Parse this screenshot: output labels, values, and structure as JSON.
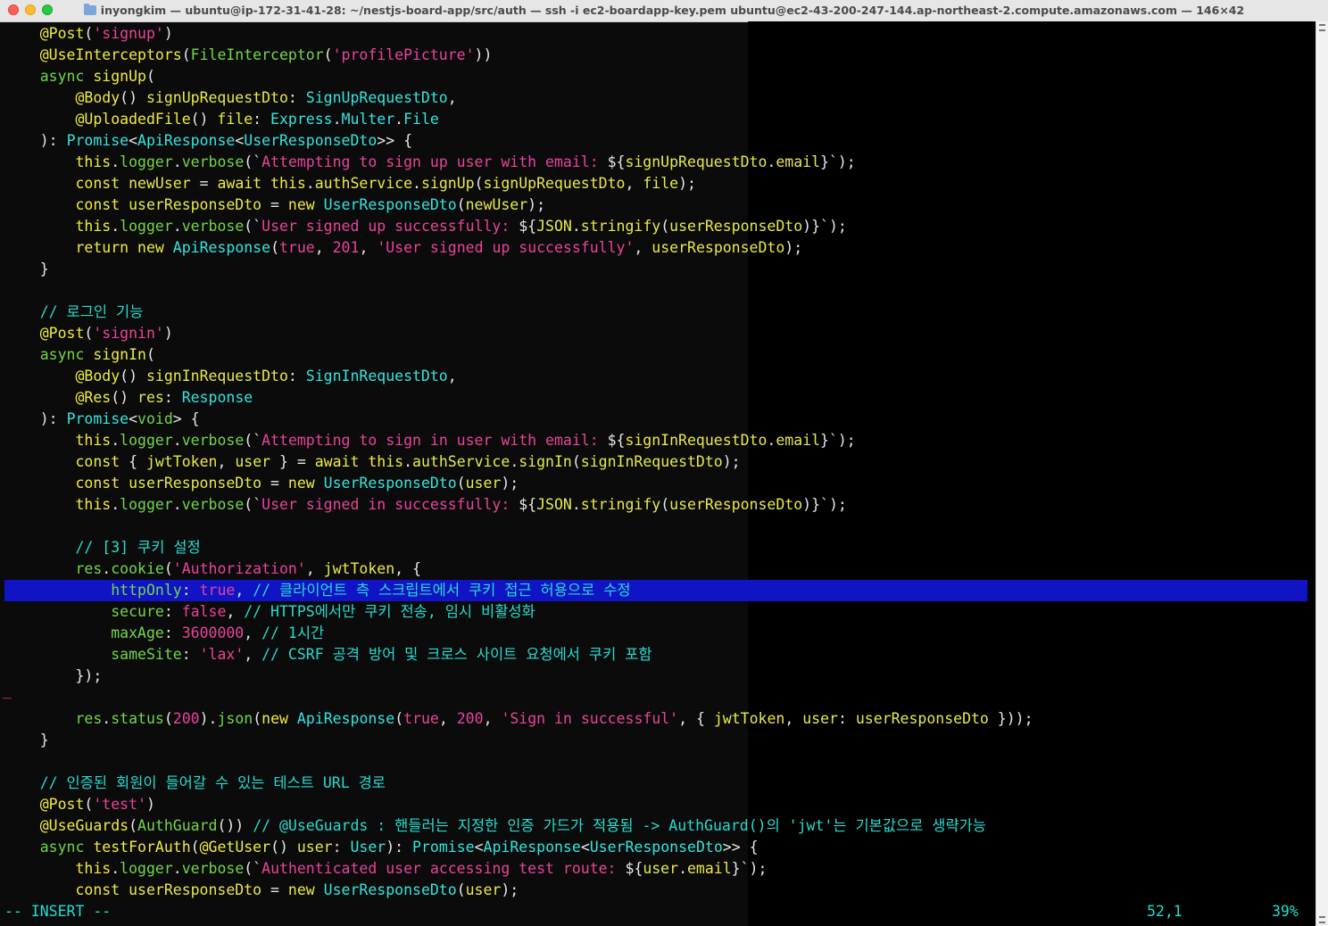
{
  "window": {
    "title": "inyongkim — ubuntu@ip-172-31-41-28: ~/nestjs-board-app/src/auth — ssh -i ec2-boardapp-key.pem ubuntu@ec2-43-200-247-144.ap-northeast-2.compute.amazonaws.com — 146×42"
  },
  "colors": {
    "decorator": "#73d64a",
    "string": "#e9439a",
    "keyword": "#f0ec3e",
    "type": "#32e6e0",
    "ident": "#e9e94a",
    "comment": "#26dcd0",
    "paren": "#e8e8e8",
    "number": "#e9439a",
    "cursor_line_bg": "#1014c4",
    "status": "#1ee0d4"
  },
  "lines": [
    [
      [
        "    ",
        "p"
      ],
      [
        "@Post",
        "k"
      ],
      [
        "(",
        "p"
      ],
      [
        "'signup'",
        "s"
      ],
      [
        ")",
        "p"
      ]
    ],
    [
      [
        "    ",
        "p"
      ],
      [
        "@UseInterceptors",
        "k"
      ],
      [
        "(",
        "p"
      ],
      [
        "FileInterceptor",
        "d"
      ],
      [
        "(",
        "p"
      ],
      [
        "'profilePicture'",
        "s"
      ],
      [
        "))",
        "p"
      ]
    ],
    [
      [
        "    ",
        "p"
      ],
      [
        "async",
        "d"
      ],
      [
        " signUp",
        "k"
      ],
      [
        "(",
        "p"
      ]
    ],
    [
      [
        "        ",
        "p"
      ],
      [
        "@Body",
        "k"
      ],
      [
        "()",
        "p"
      ],
      [
        " signUpRequestDto",
        "i"
      ],
      [
        ": ",
        "p"
      ],
      [
        "SignUpRequestDto",
        "t"
      ],
      [
        ",",
        "p"
      ]
    ],
    [
      [
        "        ",
        "p"
      ],
      [
        "@UploadedFile",
        "k"
      ],
      [
        "()",
        "p"
      ],
      [
        " file",
        "i"
      ],
      [
        ": ",
        "p"
      ],
      [
        "Express",
        "t"
      ],
      [
        ".",
        "p"
      ],
      [
        "Multer",
        "t"
      ],
      [
        ".",
        "p"
      ],
      [
        "File",
        "t"
      ]
    ],
    [
      [
        "    ",
        "p"
      ],
      [
        "): ",
        "p"
      ],
      [
        "Promise",
        "t"
      ],
      [
        "<",
        "p"
      ],
      [
        "ApiResponse",
        "t"
      ],
      [
        "<",
        "p"
      ],
      [
        "UserResponseDto",
        "t"
      ],
      [
        ">> {",
        "p"
      ]
    ],
    [
      [
        "        ",
        "p"
      ],
      [
        "this",
        "k"
      ],
      [
        ".",
        "p"
      ],
      [
        "logger",
        "d"
      ],
      [
        ".",
        "p"
      ],
      [
        "verbose",
        "d"
      ],
      [
        "(`",
        "p"
      ],
      [
        "Attempting to sign up user with email: ",
        "s"
      ],
      [
        "${",
        "p"
      ],
      [
        "signUpRequestDto",
        "i"
      ],
      [
        ".",
        "p"
      ],
      [
        "email",
        "i"
      ],
      [
        "}",
        "p"
      ],
      [
        "`);",
        "p"
      ]
    ],
    [
      [
        "        ",
        "p"
      ],
      [
        "const",
        "k"
      ],
      [
        " newUser",
        "i"
      ],
      [
        " = ",
        "p"
      ],
      [
        "await",
        "k"
      ],
      [
        " this",
        "k"
      ],
      [
        ".",
        "p"
      ],
      [
        "authService",
        "i"
      ],
      [
        ".",
        "p"
      ],
      [
        "signUp",
        "i"
      ],
      [
        "(",
        "p"
      ],
      [
        "signUpRequestDto",
        "i"
      ],
      [
        ", ",
        "p"
      ],
      [
        "file",
        "i"
      ],
      [
        ");",
        "p"
      ]
    ],
    [
      [
        "        ",
        "p"
      ],
      [
        "const",
        "k"
      ],
      [
        " userResponseDto",
        "i"
      ],
      [
        " = ",
        "p"
      ],
      [
        "new",
        "k"
      ],
      [
        " UserResponseDto",
        "t"
      ],
      [
        "(",
        "p"
      ],
      [
        "newUser",
        "i"
      ],
      [
        ");",
        "p"
      ]
    ],
    [
      [
        "        ",
        "p"
      ],
      [
        "this",
        "k"
      ],
      [
        ".",
        "p"
      ],
      [
        "logger",
        "d"
      ],
      [
        ".",
        "p"
      ],
      [
        "verbose",
        "d"
      ],
      [
        "(`",
        "p"
      ],
      [
        "User signed up successfully: ",
        "s"
      ],
      [
        "${",
        "p"
      ],
      [
        "JSON",
        "i"
      ],
      [
        ".",
        "p"
      ],
      [
        "stringify",
        "i"
      ],
      [
        "(",
        "p"
      ],
      [
        "userResponseDto",
        "i"
      ],
      [
        ")}",
        "p"
      ],
      [
        "`);",
        "p"
      ]
    ],
    [
      [
        "        ",
        "p"
      ],
      [
        "return",
        "k"
      ],
      [
        " new",
        "k"
      ],
      [
        " ApiResponse",
        "t"
      ],
      [
        "(",
        "p"
      ],
      [
        "true",
        "s"
      ],
      [
        ", ",
        "p"
      ],
      [
        "201",
        "s"
      ],
      [
        ", ",
        "p"
      ],
      [
        "'User signed up successfully'",
        "s"
      ],
      [
        ", ",
        "p"
      ],
      [
        "userResponseDto",
        "i"
      ],
      [
        ");",
        "p"
      ]
    ],
    [
      [
        "    ",
        "p"
      ],
      [
        "}",
        "p"
      ]
    ],
    [
      [
        "",
        "p"
      ]
    ],
    [
      [
        "    ",
        "p"
      ],
      [
        "// 로그인 기능",
        "c"
      ]
    ],
    [
      [
        "    ",
        "p"
      ],
      [
        "@Post",
        "k"
      ],
      [
        "(",
        "p"
      ],
      [
        "'signin'",
        "s"
      ],
      [
        ")",
        "p"
      ]
    ],
    [
      [
        "    ",
        "p"
      ],
      [
        "async",
        "d"
      ],
      [
        " signIn",
        "k"
      ],
      [
        "(",
        "p"
      ]
    ],
    [
      [
        "        ",
        "p"
      ],
      [
        "@Body",
        "k"
      ],
      [
        "()",
        "p"
      ],
      [
        " signInRequestDto",
        "i"
      ],
      [
        ": ",
        "p"
      ],
      [
        "SignInRequestDto",
        "t"
      ],
      [
        ",",
        "p"
      ]
    ],
    [
      [
        "        ",
        "p"
      ],
      [
        "@Res",
        "k"
      ],
      [
        "()",
        "p"
      ],
      [
        " res",
        "i"
      ],
      [
        ": ",
        "p"
      ],
      [
        "Response",
        "t"
      ]
    ],
    [
      [
        "    ",
        "p"
      ],
      [
        "): ",
        "p"
      ],
      [
        "Promise",
        "t"
      ],
      [
        "<",
        "p"
      ],
      [
        "void",
        "d"
      ],
      [
        "> {",
        "p"
      ]
    ],
    [
      [
        "        ",
        "p"
      ],
      [
        "this",
        "k"
      ],
      [
        ".",
        "p"
      ],
      [
        "logger",
        "d"
      ],
      [
        ".",
        "p"
      ],
      [
        "verbose",
        "d"
      ],
      [
        "(`",
        "p"
      ],
      [
        "Attempting to sign in user with email: ",
        "s"
      ],
      [
        "${",
        "p"
      ],
      [
        "signInRequestDto",
        "i"
      ],
      [
        ".",
        "p"
      ],
      [
        "email",
        "i"
      ],
      [
        "}",
        "p"
      ],
      [
        "`);",
        "p"
      ]
    ],
    [
      [
        "        ",
        "p"
      ],
      [
        "const",
        "k"
      ],
      [
        " { ",
        "p"
      ],
      [
        "jwtToken",
        "i"
      ],
      [
        ", ",
        "p"
      ],
      [
        "user",
        "i"
      ],
      [
        " } = ",
        "p"
      ],
      [
        "await",
        "k"
      ],
      [
        " this",
        "k"
      ],
      [
        ".",
        "p"
      ],
      [
        "authService",
        "i"
      ],
      [
        ".",
        "p"
      ],
      [
        "signIn",
        "i"
      ],
      [
        "(",
        "p"
      ],
      [
        "signInRequestDto",
        "i"
      ],
      [
        ");",
        "p"
      ]
    ],
    [
      [
        "        ",
        "p"
      ],
      [
        "const",
        "k"
      ],
      [
        " userResponseDto",
        "i"
      ],
      [
        " = ",
        "p"
      ],
      [
        "new",
        "k"
      ],
      [
        " UserResponseDto",
        "t"
      ],
      [
        "(",
        "p"
      ],
      [
        "user",
        "i"
      ],
      [
        ");",
        "p"
      ]
    ],
    [
      [
        "        ",
        "p"
      ],
      [
        "this",
        "k"
      ],
      [
        ".",
        "p"
      ],
      [
        "logger",
        "d"
      ],
      [
        ".",
        "p"
      ],
      [
        "verbose",
        "d"
      ],
      [
        "(`",
        "p"
      ],
      [
        "User signed in successfully: ",
        "s"
      ],
      [
        "${",
        "p"
      ],
      [
        "JSON",
        "i"
      ],
      [
        ".",
        "p"
      ],
      [
        "stringify",
        "i"
      ],
      [
        "(",
        "p"
      ],
      [
        "userResponseDto",
        "i"
      ],
      [
        ")}",
        "p"
      ],
      [
        "`);",
        "p"
      ]
    ],
    [
      [
        "",
        "p"
      ]
    ],
    [
      [
        "        ",
        "p"
      ],
      [
        "// [3] 쿠키 설정",
        "c"
      ]
    ],
    [
      [
        "        ",
        "p"
      ],
      [
        "res",
        "d"
      ],
      [
        ".",
        "p"
      ],
      [
        "cookie",
        "d"
      ],
      [
        "(",
        "p"
      ],
      [
        "'Authorization'",
        "s"
      ],
      [
        ", ",
        "p"
      ],
      [
        "jwtToken",
        "i"
      ],
      [
        ", {",
        "p"
      ]
    ],
    [
      [
        "            ",
        "p"
      ],
      [
        "httpOnly",
        "d"
      ],
      [
        ": ",
        "p"
      ],
      [
        "true",
        "s"
      ],
      [
        ", ",
        "p"
      ],
      [
        "// 클라이언트 측 스크립트에서 쿠키 접근 허용으로 수정",
        "c"
      ]
    ],
    [
      [
        "            ",
        "p"
      ],
      [
        "secure",
        "d"
      ],
      [
        ": ",
        "p"
      ],
      [
        "false",
        "s"
      ],
      [
        ", ",
        "p"
      ],
      [
        "// HTTPS에서만 쿠키 전송, 임시 비활성화",
        "c"
      ]
    ],
    [
      [
        "            ",
        "p"
      ],
      [
        "maxAge",
        "d"
      ],
      [
        ": ",
        "p"
      ],
      [
        "3600000",
        "s"
      ],
      [
        ", ",
        "p"
      ],
      [
        "// 1시간",
        "c"
      ]
    ],
    [
      [
        "            ",
        "p"
      ],
      [
        "sameSite",
        "d"
      ],
      [
        ": ",
        "p"
      ],
      [
        "'lax'",
        "s"
      ],
      [
        ", ",
        "p"
      ],
      [
        "// CSRF 공격 방어 및 크로스 사이트 요청에서 쿠키 포함",
        "c"
      ]
    ],
    [
      [
        "        ",
        "p"
      ],
      [
        "});",
        "p"
      ]
    ],
    [
      [
        "",
        "p"
      ]
    ],
    [
      [
        "        ",
        "p"
      ],
      [
        "res",
        "d"
      ],
      [
        ".",
        "p"
      ],
      [
        "status",
        "d"
      ],
      [
        "(",
        "p"
      ],
      [
        "200",
        "s"
      ],
      [
        ").",
        "p"
      ],
      [
        "json",
        "d"
      ],
      [
        "(",
        "p"
      ],
      [
        "new",
        "k"
      ],
      [
        " ApiResponse",
        "t"
      ],
      [
        "(",
        "p"
      ],
      [
        "true",
        "s"
      ],
      [
        ", ",
        "p"
      ],
      [
        "200",
        "s"
      ],
      [
        ", ",
        "p"
      ],
      [
        "'Sign in successful'",
        "s"
      ],
      [
        ", { ",
        "p"
      ],
      [
        "jwtToken",
        "i"
      ],
      [
        ", ",
        "p"
      ],
      [
        "user",
        "i"
      ],
      [
        ": ",
        "p"
      ],
      [
        "userResponseDto",
        "i"
      ],
      [
        " }));",
        "p"
      ]
    ],
    [
      [
        "    ",
        "p"
      ],
      [
        "}",
        "p"
      ]
    ],
    [
      [
        "",
        "p"
      ]
    ],
    [
      [
        "    ",
        "p"
      ],
      [
        "// 인증된 회원이 들어갈 수 있는 테스트 URL 경로",
        "c"
      ]
    ],
    [
      [
        "    ",
        "p"
      ],
      [
        "@Post",
        "k"
      ],
      [
        "(",
        "p"
      ],
      [
        "'test'",
        "s"
      ],
      [
        ")",
        "p"
      ]
    ],
    [
      [
        "    ",
        "p"
      ],
      [
        "@UseGuards",
        "k"
      ],
      [
        "(",
        "p"
      ],
      [
        "AuthGuard",
        "d"
      ],
      [
        "()) ",
        "p"
      ],
      [
        "// @UseGuards : 핸들러는 지정한 인증 가드가 적용됨 -> AuthGuard()의 'jwt'는 기본값으로 생략가능",
        "c"
      ]
    ],
    [
      [
        "    ",
        "p"
      ],
      [
        "async",
        "d"
      ],
      [
        " testForAuth",
        "k"
      ],
      [
        "(",
        "p"
      ],
      [
        "@GetUser",
        "k"
      ],
      [
        "()",
        "p"
      ],
      [
        " user",
        "i"
      ],
      [
        ": ",
        "p"
      ],
      [
        "User",
        "t"
      ],
      [
        "): ",
        "p"
      ],
      [
        "Promise",
        "t"
      ],
      [
        "<",
        "p"
      ],
      [
        "ApiResponse",
        "t"
      ],
      [
        "<",
        "p"
      ],
      [
        "UserResponseDto",
        "t"
      ],
      [
        ">> {",
        "p"
      ]
    ],
    [
      [
        "        ",
        "p"
      ],
      [
        "this",
        "k"
      ],
      [
        ".",
        "p"
      ],
      [
        "logger",
        "d"
      ],
      [
        ".",
        "p"
      ],
      [
        "verbose",
        "d"
      ],
      [
        "(`",
        "p"
      ],
      [
        "Authenticated user accessing test route: ",
        "s"
      ],
      [
        "${",
        "p"
      ],
      [
        "user",
        "i"
      ],
      [
        ".",
        "p"
      ],
      [
        "email",
        "i"
      ],
      [
        "}",
        "p"
      ],
      [
        "`);",
        "p"
      ]
    ],
    [
      [
        "        ",
        "p"
      ],
      [
        "const",
        "k"
      ],
      [
        " userResponseDto",
        "i"
      ],
      [
        " = ",
        "p"
      ],
      [
        "new",
        "k"
      ],
      [
        " UserResponseDto",
        "t"
      ],
      [
        "(",
        "p"
      ],
      [
        "user",
        "i"
      ],
      [
        ");",
        "p"
      ]
    ]
  ],
  "cursor_line_index": 26,
  "change_marker": {
    "line_index": 31,
    "text": "_"
  },
  "status": {
    "mode": "-- INSERT --",
    "position": "52,1",
    "percent": "39%"
  }
}
